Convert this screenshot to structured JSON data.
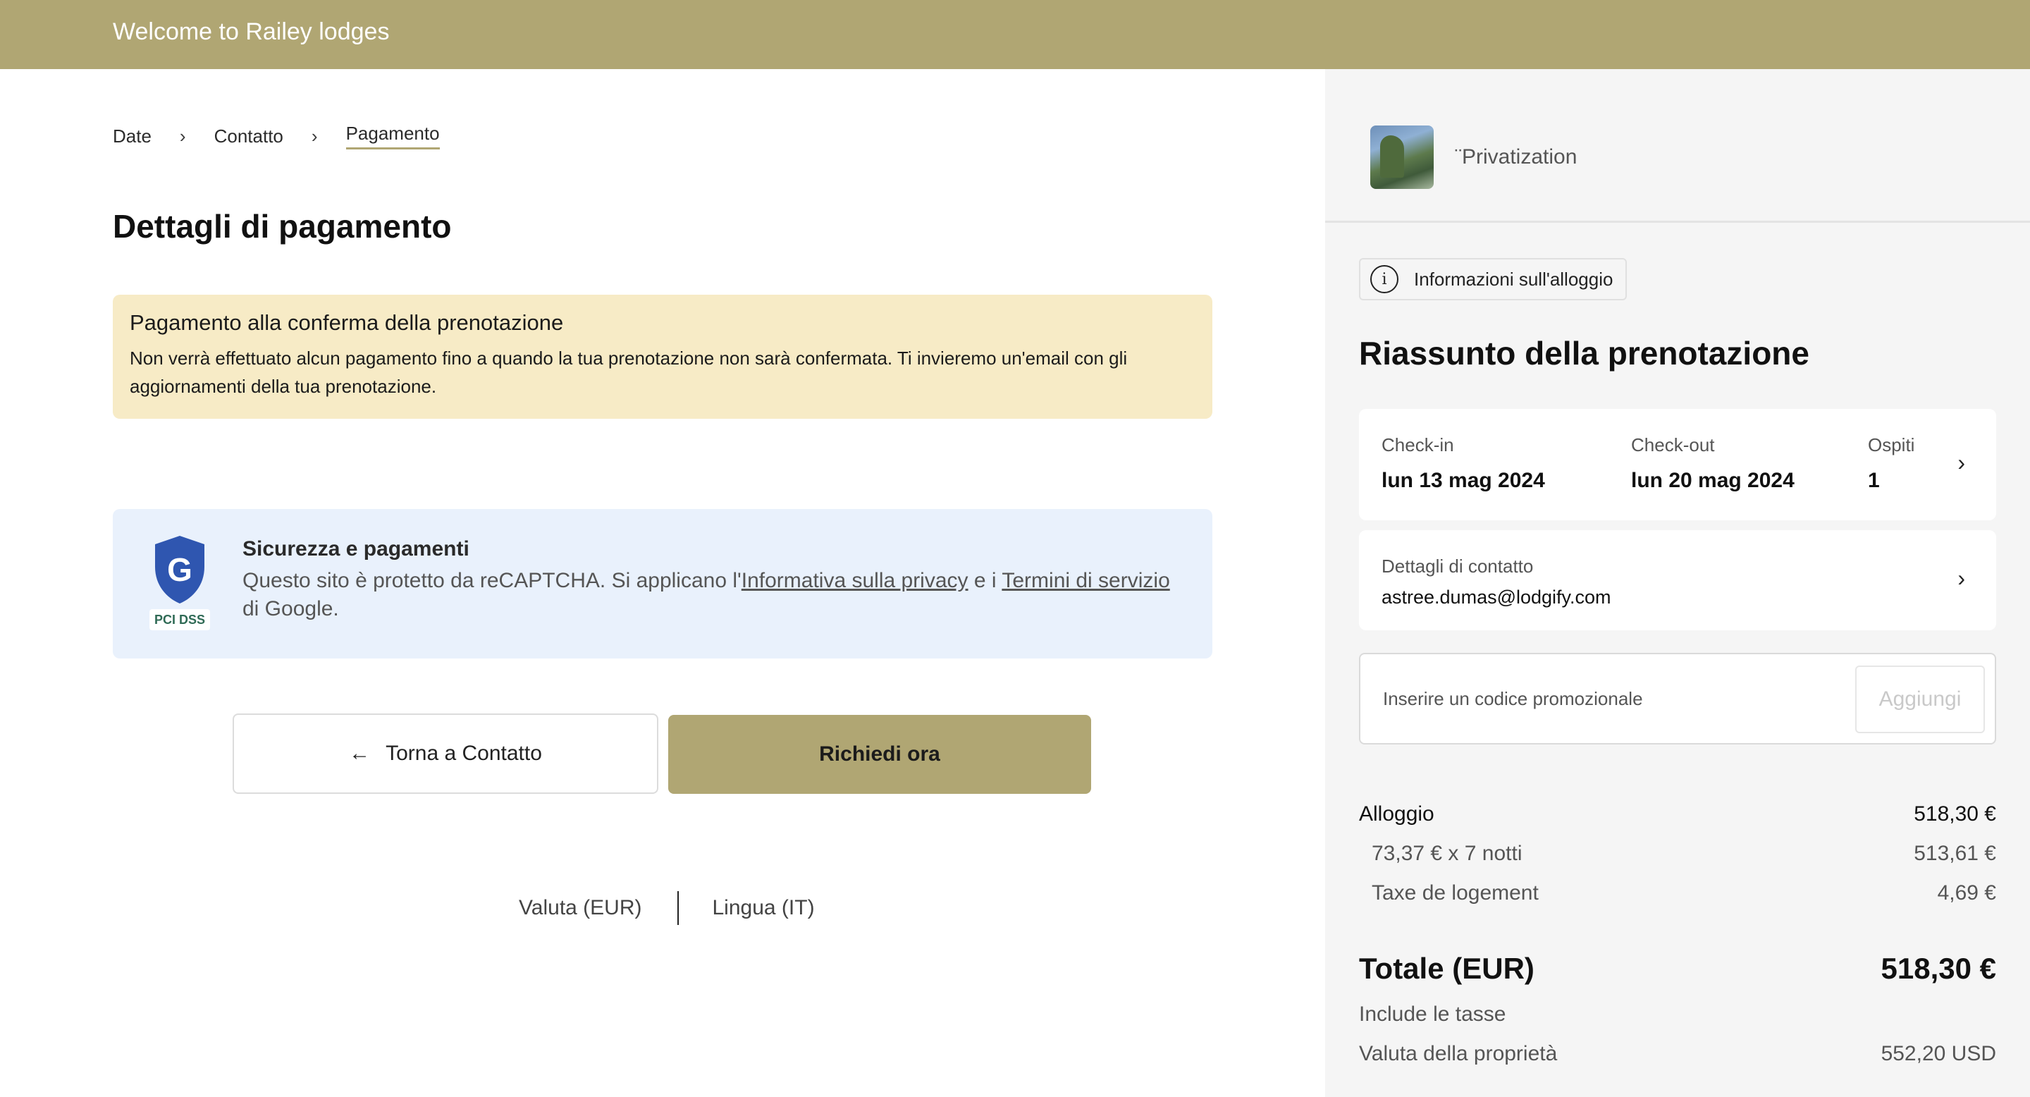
{
  "header": {
    "welcome": "Welcome to Railey lodges"
  },
  "breadcrumb": {
    "items": [
      "Date",
      "Contatto",
      "Pagamento"
    ],
    "separator": "›"
  },
  "page_title": "Dettagli di pagamento",
  "notice": {
    "title": "Pagamento alla conferma della prenotazione",
    "text": "Non verrà effettuato alcun pagamento fino a quando la tua prenotazione non sarà confermata. Ti invieremo un'email con gli aggiornamenti della tua prenotazione."
  },
  "security": {
    "title": "Sicurezza e pagamenti",
    "text_before": "Questo sito è protetto da reCAPTCHA. Si applicano l'",
    "privacy_link": "Informativa sulla privacy",
    "text_middle": " e i ",
    "terms_link": "Termini di servizio",
    "text_after": " di Google.",
    "logo_text": "G",
    "badge_text": "PCI DSS"
  },
  "actions": {
    "back_label": "Torna a Contatto",
    "back_icon": "arrow-left-icon",
    "request_label": "Richiedi ora"
  },
  "footer": {
    "currency": "Valuta (EUR)",
    "language": "Lingua (IT)"
  },
  "property": {
    "name": "¨Privatization"
  },
  "sidebar": {
    "info_label": "Informazioni sull'alloggio",
    "summary_title": "Riassunto della prenotazione",
    "checkin_label": "Check-in",
    "checkin_value": "lun 13 mag 2024",
    "checkout_label": "Check-out",
    "checkout_value": "lun 20 mag 2024",
    "guests_label": "Ospiti",
    "guests_value": "1",
    "contact_label": "Dettagli di contatto",
    "contact_value": "astree.dumas@lodgify.com",
    "promo_placeholder": "Inserire un codice promozionale",
    "promo_button": "Aggiungi"
  },
  "pricing": {
    "lodging_label": "Alloggio",
    "lodging_value": "518,30 €",
    "nights_label": "73,37 € x 7 notti",
    "nights_value": "513,61 €",
    "tax_label": "Taxe de logement",
    "tax_value": "4,69 €",
    "total_label": "Totale (EUR)",
    "total_value": "518,30 €",
    "taxes_note": "Include le tasse",
    "property_currency_label": "Valuta della proprietà",
    "property_currency_value": "552,20 USD"
  },
  "colors": {
    "brand": "#b0a673",
    "notice_bg": "#f7ebc6",
    "security_bg": "#e9f1fc",
    "sidebar_bg": "#f5f5f5"
  }
}
